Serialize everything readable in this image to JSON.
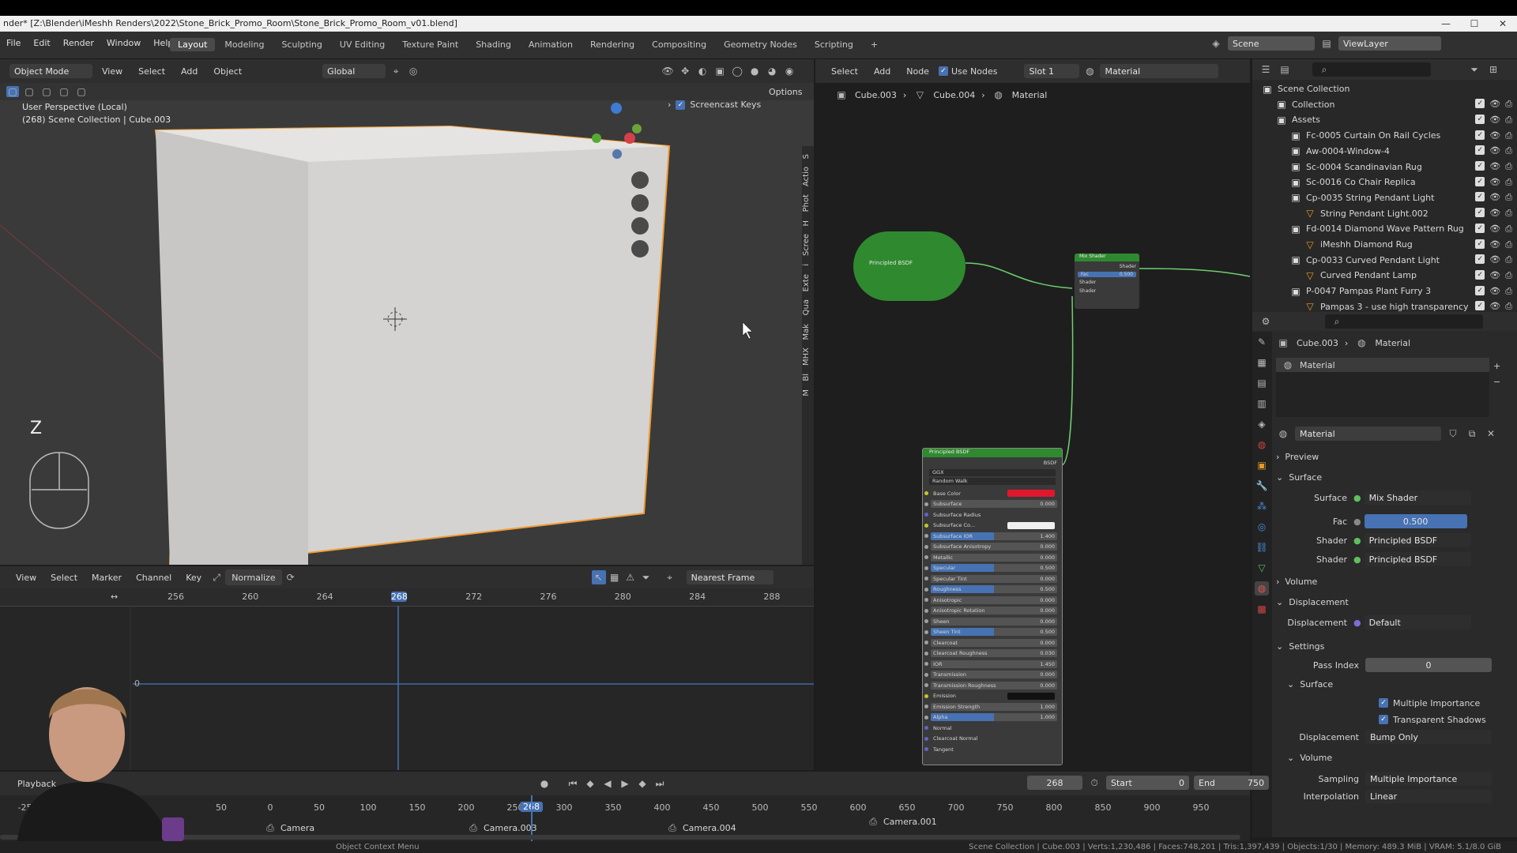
{
  "window": {
    "title": "nder* [Z:\\Blender\\iMeshh Renders\\2022\\Stone_Brick_Promo_Room\\Stone_Brick_Promo_Room_v01.blend]"
  },
  "menu": [
    "File",
    "Edit",
    "Render",
    "Window",
    "Help"
  ],
  "workspaces": [
    "Layout",
    "Modeling",
    "Sculpting",
    "UV Editing",
    "Texture Paint",
    "Shading",
    "Animation",
    "Rendering",
    "Compositing",
    "Geometry Nodes",
    "Scripting"
  ],
  "top_right": {
    "scene": "Scene",
    "view_layer": "ViewLayer"
  },
  "viewport": {
    "mode": "Object Mode",
    "menu": [
      "View",
      "Select",
      "Add",
      "Object"
    ],
    "orientation": "Global",
    "options": "Options",
    "perspective": "User Perspective (Local)",
    "collection_info": "(268) Scene Collection | Cube.003",
    "screencast": "Screencast Keys",
    "axis_label": "Z",
    "side_tabs": [
      "S",
      "Actio",
      "Phot",
      "H",
      "Scree",
      "i",
      "Exte",
      "Qua",
      "Mak",
      "MHX",
      "Bl",
      "M"
    ]
  },
  "node_editor": {
    "menu": [
      "Select",
      "Add",
      "Node"
    ],
    "use_nodes": "Use Nodes",
    "slot": "Slot 1",
    "material": "Material",
    "breadcrumb": [
      "Cube.003",
      "Cube.004",
      "Material"
    ],
    "collapsed_node": "Principled BSDF",
    "mix_node": {
      "title": "Mix Shader",
      "out": "Shader",
      "fac_label": "Fac",
      "fac": "0.500",
      "in1": "Shader",
      "in2": "Shader"
    },
    "bsdf_node": {
      "title": "Principled BSDF",
      "out": "BSDF",
      "dist": "GGX",
      "sss": "Random Walk",
      "rows": [
        {
          "label": "Base Color",
          "value": ""
        },
        {
          "label": "Subsurface",
          "value": "0.000"
        },
        {
          "label": "Subsurface Radius",
          "value": ""
        },
        {
          "label": "Subsurface Co...",
          "value": ""
        },
        {
          "label": "Subsurface IOR",
          "value": "1.400"
        },
        {
          "label": "Subsurface Anisotropy",
          "value": "0.000"
        },
        {
          "label": "Metallic",
          "value": "0.000"
        },
        {
          "label": "Specular",
          "value": "0.500"
        },
        {
          "label": "Specular Tint",
          "value": "0.000"
        },
        {
          "label": "Roughness",
          "value": "0.500"
        },
        {
          "label": "Anisotropic",
          "value": "0.000"
        },
        {
          "label": "Anisotropic Rotation",
          "value": "0.000"
        },
        {
          "label": "Sheen",
          "value": "0.000"
        },
        {
          "label": "Sheen Tint",
          "value": "0.500"
        },
        {
          "label": "Clearcoat",
          "value": "0.000"
        },
        {
          "label": "Clearcoat Roughness",
          "value": "0.030"
        },
        {
          "label": "IOR",
          "value": "1.450"
        },
        {
          "label": "Transmission",
          "value": "0.000"
        },
        {
          "label": "Transmission Roughness",
          "value": "0.000"
        },
        {
          "label": "Emission",
          "value": ""
        },
        {
          "label": "Emission Strength",
          "value": "1.000"
        },
        {
          "label": "Alpha",
          "value": "1.000"
        },
        {
          "label": "Normal",
          "value": ""
        },
        {
          "label": "Clearcoat Normal",
          "value": ""
        },
        {
          "label": "Tangent",
          "value": ""
        }
      ]
    }
  },
  "outliner": {
    "rows": [
      {
        "label": "Scene Collection",
        "indent": 0
      },
      {
        "label": "Collection",
        "indent": 1
      },
      {
        "label": "Assets",
        "indent": 1
      },
      {
        "label": "Fc-0005 Curtain On Rail Cycles",
        "indent": 2
      },
      {
        "label": "Aw-0004-Window-4",
        "indent": 2
      },
      {
        "label": "Sc-0004 Scandinavian Rug",
        "indent": 2
      },
      {
        "label": "Sc-0016 Co Chair Replica",
        "indent": 2
      },
      {
        "label": "Cp-0035 String Pendant Light",
        "indent": 2
      },
      {
        "label": "String Pendant Light.002",
        "indent": 3
      },
      {
        "label": "Fd-0014 Diamond Wave Pattern Rug",
        "indent": 2
      },
      {
        "label": "iMeshh Diamond Rug",
        "indent": 3
      },
      {
        "label": "Cp-0033 Curved Pendant Light",
        "indent": 2
      },
      {
        "label": "Curved Pendant Lamp",
        "indent": 3
      },
      {
        "label": "P-0047 Pampas Plant Furry 3",
        "indent": 2
      },
      {
        "label": "Pampas 3 - use high transparency",
        "indent": 3
      }
    ]
  },
  "properties": {
    "breadcrumb": [
      "Cube.003",
      "Material"
    ],
    "slot": "Material",
    "material": "Material",
    "preview": "Preview",
    "surface_section": "Surface",
    "surface_label": "Surface",
    "surface_value": "Mix Shader",
    "fac_label": "Fac",
    "fac_value": "0.500",
    "shader_label": "Shader",
    "shader1": "Principled BSDF",
    "shader2": "Principled BSDF",
    "volume": "Volume",
    "displacement_section": "Displacement",
    "displacement_label": "Displacement",
    "displacement_value": "Default",
    "settings": "Settings",
    "pass_index_label": "Pass Index",
    "pass_index": "0",
    "sub_surface": "Surface",
    "multiple_importance": "Multiple Importance",
    "transparent_shadows": "Transparent Shadows",
    "disp_method_label": "Displacement",
    "disp_method": "Bump Only",
    "sub_volume": "Volume",
    "sampling_label": "Sampling",
    "sampling": "Multiple Importance",
    "interp_label": "Interpolation",
    "interp": "Linear"
  },
  "timeline": {
    "menu": [
      "View",
      "Select",
      "Marker",
      "Channel",
      "Key"
    ],
    "normalize": "Normalize",
    "nearest": "Nearest Frame",
    "ticks": [
      "256",
      "260",
      "264",
      "268",
      "272",
      "276",
      "280",
      "284",
      "288"
    ],
    "current": "268",
    "zero": "0"
  },
  "playback": {
    "label": "Playback",
    "frame": "268",
    "start_label": "Start",
    "start": "0",
    "end_label": "End",
    "end": "750",
    "ticks": [
      "-250",
      "50",
      "0",
      "50",
      "100",
      "150",
      "200",
      "250",
      "300",
      "350",
      "400",
      "450",
      "500",
      "550",
      "600",
      "650",
      "700",
      "750",
      "800",
      "850",
      "900",
      "950"
    ],
    "current": "268",
    "cameras": [
      "Camera",
      "Camera.003",
      "Camera.004",
      "Camera.001"
    ]
  },
  "status": {
    "left": "Object Context Menu",
    "right": "Scene Collection | Cube.003 | Verts:1,230,486 | Faces:748,201 | Tris:1,397,439 | Objects:1/30 | Memory: 489.3 MiB | VRAM: 5.1/8.0 GiB"
  },
  "colors": {
    "accent": "#4772b3",
    "selection": "#f09d37",
    "node_green": "#2f8a2f",
    "base_color": "#e0182e"
  }
}
